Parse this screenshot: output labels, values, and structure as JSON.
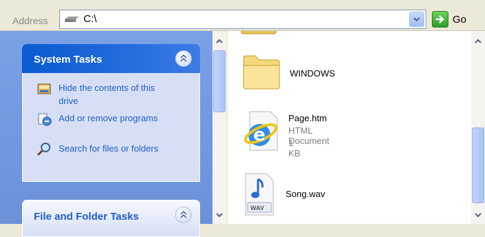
{
  "address": {
    "label": "Address",
    "value": "C:\\",
    "go_label": "Go"
  },
  "system_tasks": {
    "title": "System Tasks",
    "items": [
      {
        "label": "Hide the contents of this drive",
        "icon": "hide-contents-icon"
      },
      {
        "label": "Add or remove programs",
        "icon": "add-remove-programs-icon"
      },
      {
        "label": "Search for files or folders",
        "icon": "search-icon"
      }
    ]
  },
  "file_folder_tasks": {
    "title": "File and Folder Tasks"
  },
  "files": [
    {
      "name": "WINDOWS",
      "type": "folder"
    },
    {
      "name": "Page.htm",
      "type_label": "HTML Document",
      "size": "1 KB",
      "icon": "internet-explorer-icon"
    },
    {
      "name": "Song.wav",
      "type": "audio",
      "icon_text": "WAV"
    }
  ],
  "colors": {
    "task_header": "#0a5ad1",
    "link": "#215dc6",
    "pane_background": "#6b91d9"
  }
}
